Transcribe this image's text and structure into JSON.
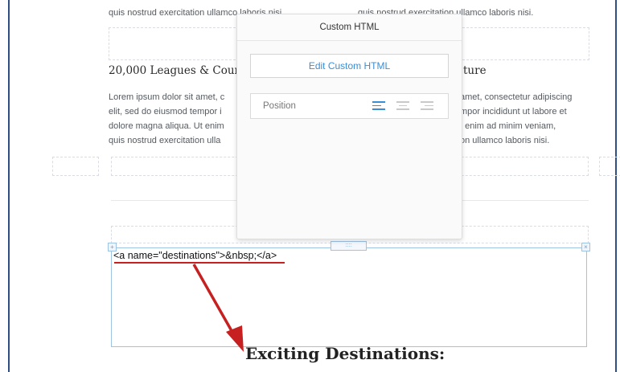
{
  "left_column": {
    "top_line": "quis nostrud exercitation ullamco laboris nisi.",
    "heading": "20,000 Leagues & Count",
    "paragraph_lines": [
      "Lorem ipsum dolor sit amet, c",
      "elit, sed do eiusmod tempor i",
      "dolore magna aliqua. Ut enim",
      "quis nostrud exercitation ulla"
    ]
  },
  "right_column": {
    "top_line": "quis nostrud exercitation ullamco laboris nisi.",
    "heading": "ture",
    "paragraph_lines": [
      "amet, consectetur adipiscing",
      "mpor incididunt ut labore et",
      "t enim ad minim veniam,",
      "on ullamco laboris nisi."
    ]
  },
  "popup": {
    "title": "Custom HTML",
    "edit_button": "Edit Custom HTML",
    "position_label": "Position",
    "alignment_options": [
      "align-left",
      "align-center",
      "align-right"
    ],
    "selected_alignment": "align-left",
    "accent_color": "#3b8ed6"
  },
  "html_block": {
    "code": "<a name=\"destinations\">&nbsp;</a>",
    "handle_glyph": "::::",
    "left_handle_glyph": "+",
    "close_glyph": "×"
  },
  "annotation": {
    "arrow_color": "#c62020"
  },
  "section_heading": "Exciting Destinations:"
}
